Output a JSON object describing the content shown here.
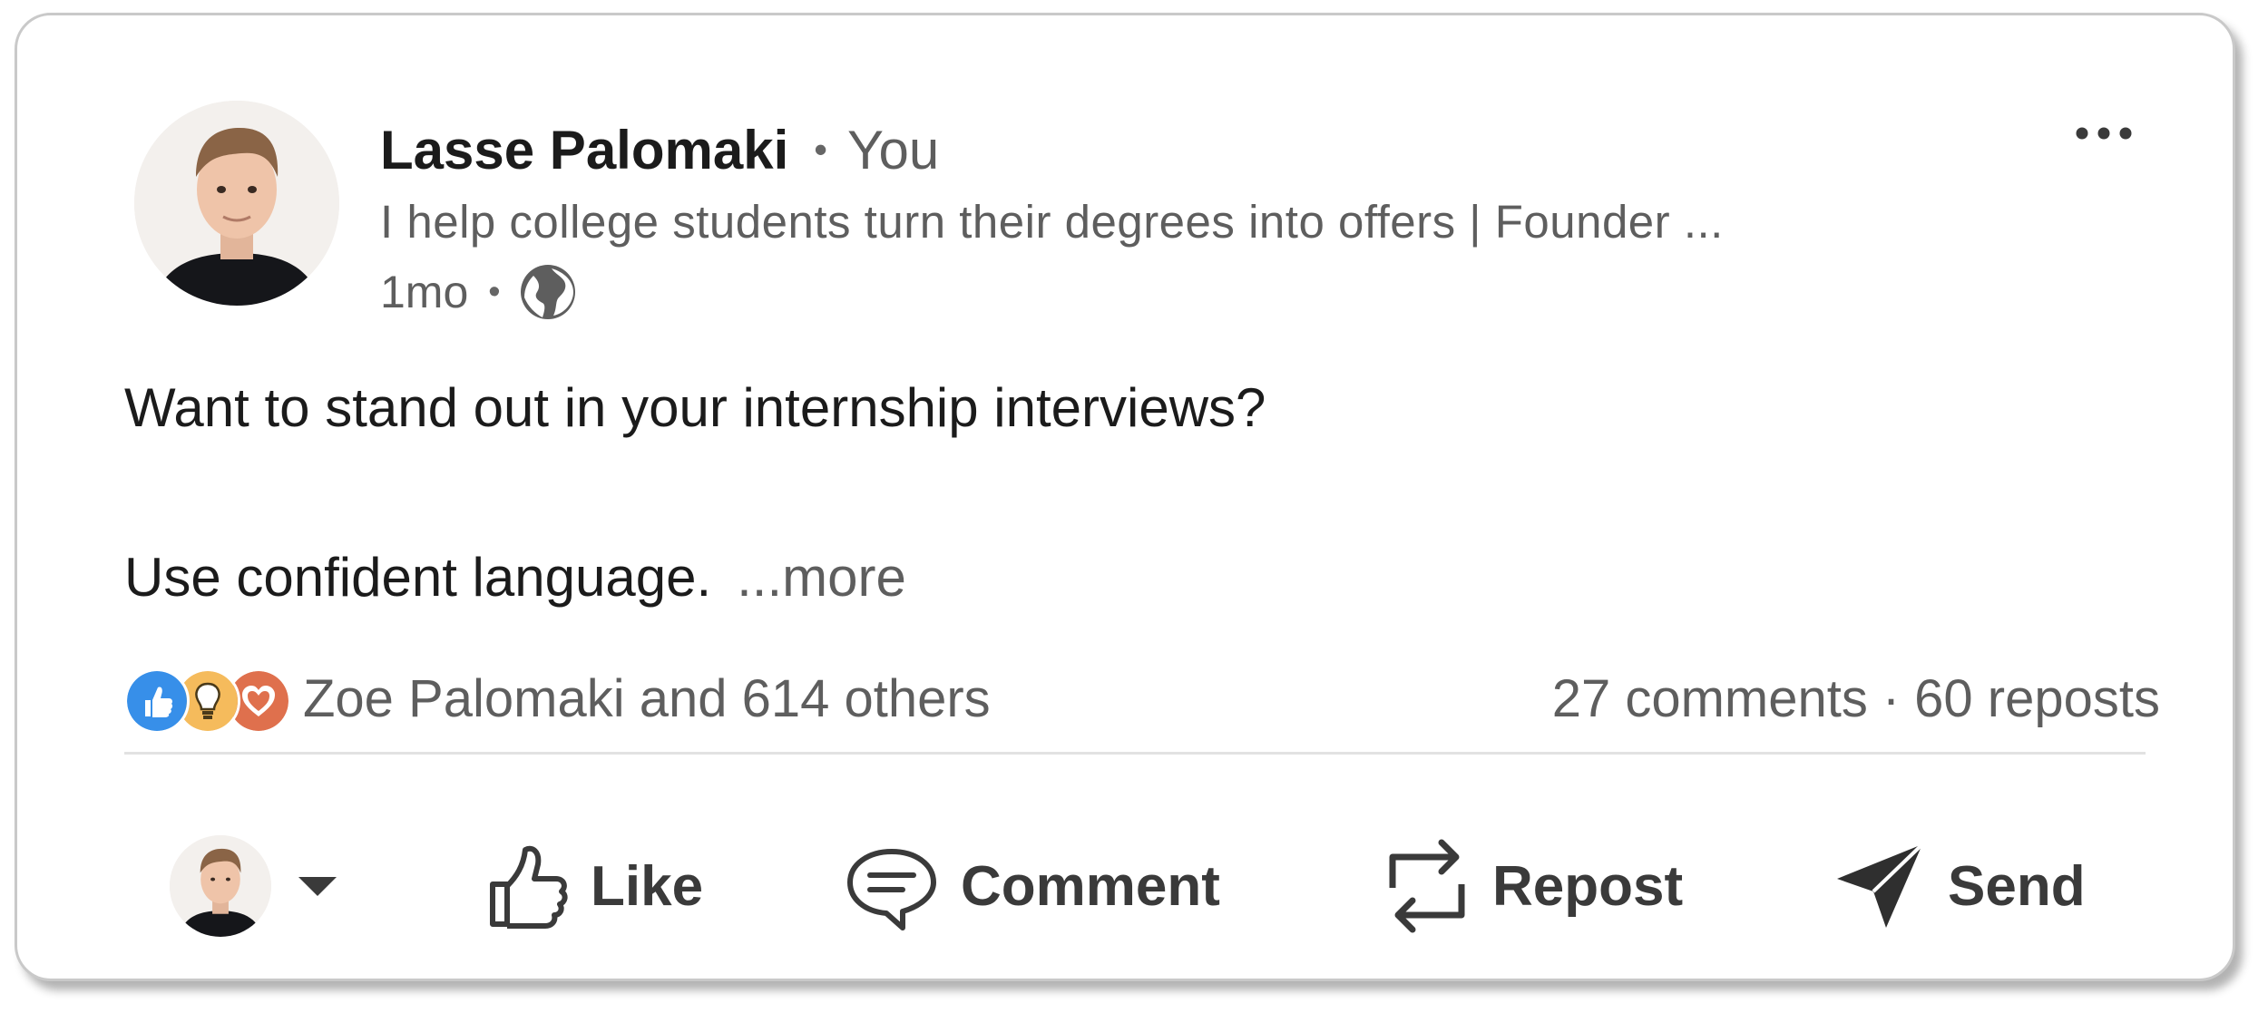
{
  "post": {
    "author": {
      "name": "Lasse Palomaki",
      "relation": "You",
      "separator": "•",
      "headline": "I help college students turn their degrees into offers | Founder ...",
      "time": "1mo",
      "time_separator": "•",
      "visibility_icon": "globe-icon",
      "avatar_icon": "avatar"
    },
    "menu_icon": "more-horizontal-icon",
    "text_line1": "Want to stand out in your internship interviews?",
    "text_line2": "Use confident language.",
    "see_more": "...more",
    "reactions": {
      "icons": [
        "like-reaction-icon",
        "insightful-reaction-icon",
        "love-reaction-icon"
      ],
      "text": "Zoe Palomaki and 614 others"
    },
    "counts": {
      "comments": "27 comments",
      "separator": "·",
      "reposts": "60 reposts"
    }
  },
  "actions": {
    "like": "Like",
    "comment": "Comment",
    "repost": "Repost",
    "send": "Send"
  },
  "colors": {
    "like_blue": "#378fe9",
    "insightful_yellow": "#f5bb5c",
    "love_red": "#df704d",
    "text_primary": "#1b1b1b",
    "text_secondary": "#5e5e5e"
  }
}
